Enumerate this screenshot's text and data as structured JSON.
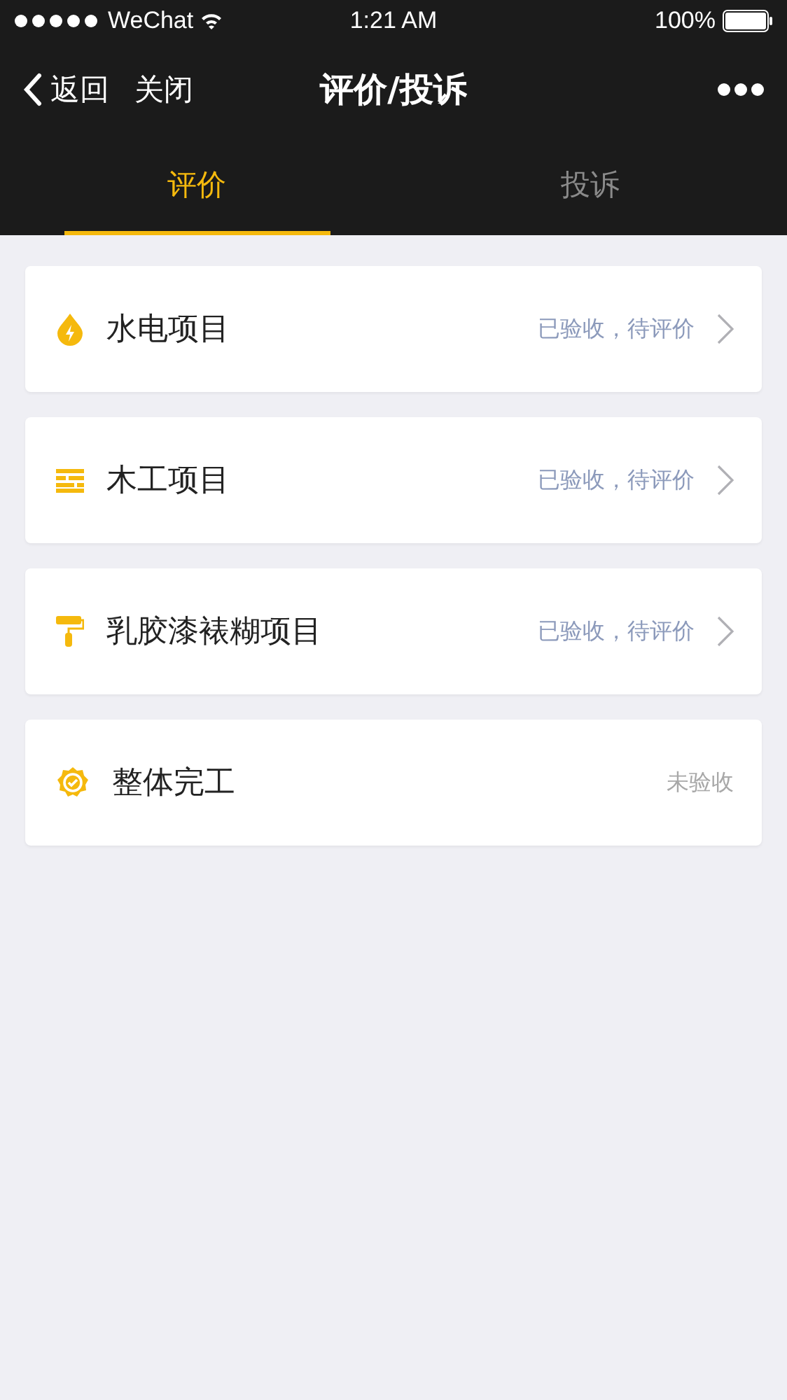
{
  "status_bar": {
    "carrier": "WeChat",
    "time": "1:21 AM",
    "battery": "100%"
  },
  "nav": {
    "back": "返回",
    "close": "关闭",
    "title": "评价/投诉"
  },
  "tabs": [
    {
      "label": "评价",
      "selected": true
    },
    {
      "label": "投诉",
      "selected": false
    }
  ],
  "items": [
    {
      "kind": "water",
      "name": "水电项目",
      "status": "已验收，待评价",
      "accepted": true
    },
    {
      "kind": "wood",
      "name": "木工项目",
      "status": "已验收，待评价",
      "accepted": true
    },
    {
      "kind": "paint",
      "name": "乳胶漆裱糊项目",
      "status": "已验收，待评价",
      "accepted": true
    },
    {
      "kind": "badge",
      "name": "整体完工",
      "status": "未验收",
      "accepted": false
    }
  ]
}
